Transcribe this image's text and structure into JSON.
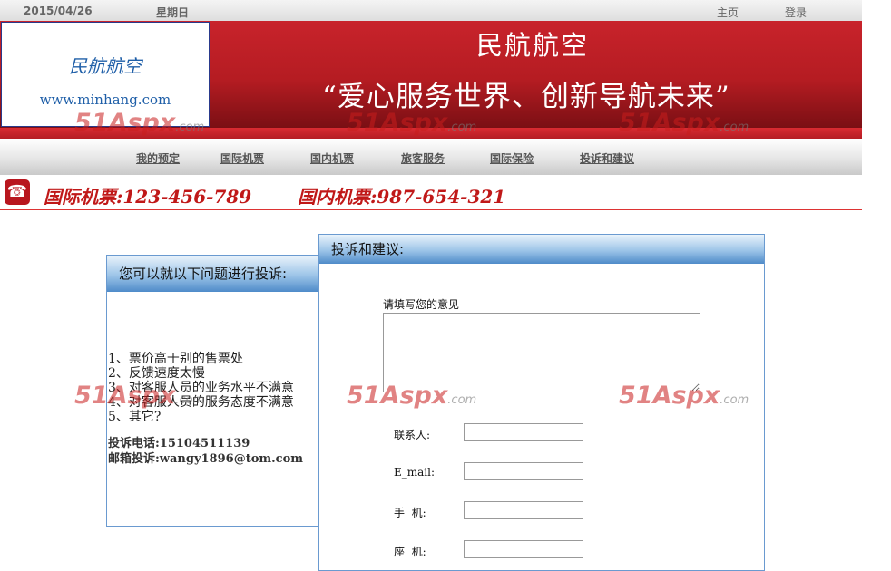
{
  "topbar": {
    "date": "2015/04/26",
    "weekday": "星期日",
    "links": [
      "主页",
      "登录"
    ]
  },
  "banner": {
    "logo_name": "民航航空",
    "logo_url": "www.minhang.com",
    "title": "民航航空",
    "slogan": "“爱心服务世界、创新导航未来”"
  },
  "nav": {
    "items": [
      "我的预定",
      "国际机票",
      "国内机票",
      "旅客服务",
      "国际保险",
      "投诉和建议"
    ]
  },
  "phones": {
    "international": "国际机票:123-456-789",
    "domestic": "国内机票:987-654-321"
  },
  "left_panel": {
    "title": "您可以就以下问题进行投诉:",
    "issues": [
      "1、票价高于别的售票处",
      "2、反馈速度太慢",
      "3、对客服人员的业务水平不满意",
      "4、对客服人员的服务态度不满意",
      "5、其它?"
    ],
    "phone": "投诉电话:15104511139",
    "email": "邮箱投诉:wangy1896@tom.com"
  },
  "right_panel": {
    "title": "投诉和建议:",
    "opinion_label": "请填写您的意见",
    "opinion_value": "",
    "fields": [
      {
        "label": "联系人:",
        "value": ""
      },
      {
        "label": "E_mail:",
        "value": ""
      },
      {
        "label": "手  机:",
        "value": ""
      },
      {
        "label": "座  机:",
        "value": ""
      }
    ]
  },
  "watermark": {
    "text": "51Aspx",
    "suffix": ".com"
  },
  "colors": {
    "brand_red": "#b51c22",
    "panel_blue": "#6a9ad0"
  }
}
